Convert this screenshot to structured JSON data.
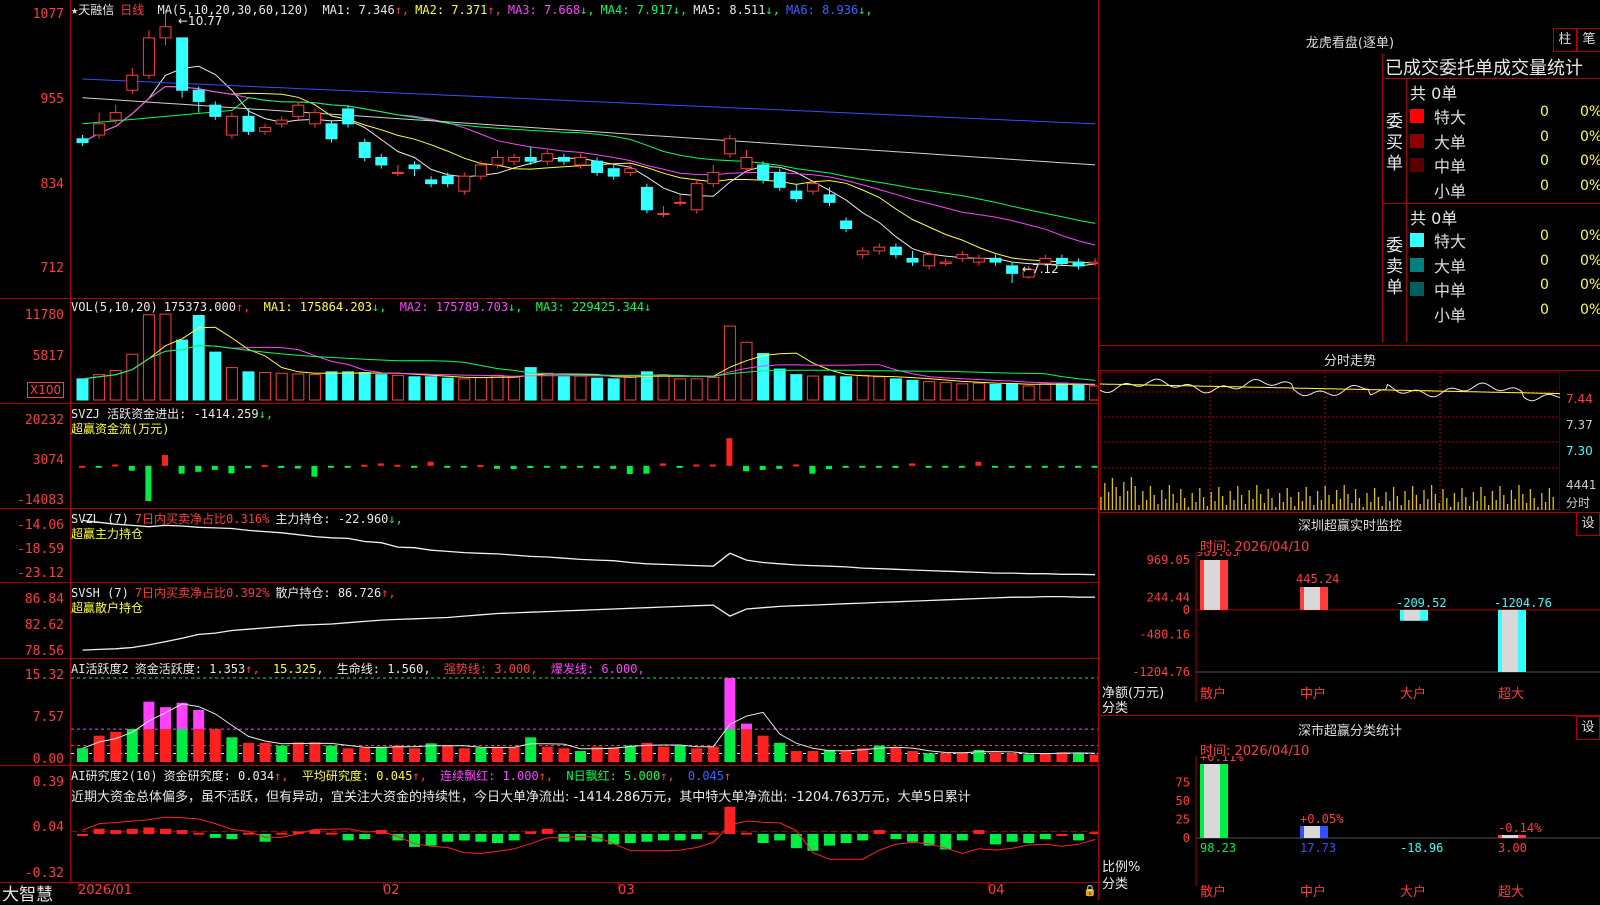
{
  "app": {
    "brand": "大智慧"
  },
  "main_chart": {
    "title": "★天融信",
    "period": "日线",
    "ma_header": "MA(5,10,20,30,60,120)",
    "ma": [
      {
        "label": "MA1: 7.346",
        "color": "#e8e8e8",
        "arrow": "↑",
        "arrow_color": "#ff3b3b"
      },
      {
        "label": "MA2: 7.371",
        "color": "#ffff33",
        "arrow": "↑",
        "arrow_color": "#ff3b3b"
      },
      {
        "label": "MA3: 7.668",
        "color": "#ff40ff",
        "arrow": "↓",
        "arrow_color": "#00ff55"
      },
      {
        "label": "MA4: 7.917",
        "color": "#00ff55",
        "arrow": "↓",
        "arrow_color": "#00ff55"
      },
      {
        "label": "MA5: 8.511",
        "color": "#e8e8e8",
        "arrow": "↓",
        "arrow_color": "#00ff55"
      },
      {
        "label": "MA6: 8.936",
        "color": "#4060ff",
        "arrow": "↓",
        "arrow_color": "#00ff55"
      }
    ],
    "y_ticks": [
      "1077",
      "955",
      "834",
      "712"
    ],
    "high_label": "←10.77",
    "low_label": "←7.12"
  },
  "vol_panel": {
    "header": "VOL(5,10,20)",
    "value": "175373.000",
    "ma1": "MA1: 175864.203",
    "ma2": "MA2: 175789.703",
    "ma3": "MA3: 229425.344",
    "y_ticks": [
      "11780",
      "5817"
    ],
    "unit": "X100"
  },
  "svzj_panel": {
    "header": "SVZJ  活跃资金进出: -1414.259",
    "sub": "超赢资金流(万元)",
    "y_ticks": [
      "20232",
      "3074",
      "-14083"
    ]
  },
  "svzl_panel": {
    "header_a": "SVZL (7)",
    "header_b": "7日内买卖净占比0.316%",
    "header_c": "主力持仓: -22.960",
    "sub": "超赢主力持仓",
    "y_ticks": [
      "-14.06",
      "-18.59",
      "-23.12"
    ]
  },
  "svsh_panel": {
    "header_a": "SVSH (7)",
    "header_b": "7日内买卖净占比0.392%",
    "header_c": "散户持仓: 86.726",
    "sub": "超赢散户持仓",
    "y_ticks": [
      "86.84",
      "82.62",
      "78.56"
    ]
  },
  "ai_active_panel": {
    "header_a": "AI活跃度2",
    "header_b": "资金活跃度: 1.353",
    "header_c": "15.325",
    "header_d": "生命线: 1.560",
    "header_e": "强势线: 3.000",
    "header_f": "爆发线: 6.000",
    "y_ticks": [
      "15.32",
      "7.57",
      "0.00"
    ]
  },
  "ai_research_panel": {
    "header_a": "AI研究度2(10)",
    "header_b": "资金研究度: 0.034",
    "header_c": "平均研究度: 0.045",
    "header_d": "连续飘红: 1.000",
    "header_e": "N日飘红: 5.000",
    "header_f": "0.045",
    "commentary": "近期大资金总体偏多，虽不活跃，但有异动，宜关注大资金的持续性，今日大单净流出: -1414.286万元，其中特大单净流出: -1204.763万元，大单5日累计",
    "y_ticks": [
      "0.39",
      "0.04",
      "-0.32"
    ]
  },
  "x_axis": {
    "labels": [
      "2026/01",
      "02",
      "03",
      "04"
    ]
  },
  "right_panel": {
    "lhb": {
      "title": "龙虎看盘(逐单)",
      "btn1": "柱",
      "btn2": "笔",
      "header": "已成交委托单成交量统计",
      "buy_label": "委买单",
      "sell_label": "委卖单",
      "buy_total": "共 0单",
      "sell_total": "共 0单",
      "buy_rows": [
        {
          "name": "特大",
          "v1": "0",
          "v2": "0%",
          "color": "#ff0000"
        },
        {
          "name": "大单",
          "v1": "0",
          "v2": "0%",
          "color": "#8b0000"
        },
        {
          "name": "中单",
          "v1": "0",
          "v2": "0%",
          "color": "#5a0000"
        },
        {
          "name": "小单",
          "v1": "0",
          "v2": "0%",
          "color": "#000000"
        }
      ],
      "sell_rows": [
        {
          "name": "特大",
          "v1": "0",
          "v2": "0%",
          "color": "#33ffff"
        },
        {
          "name": "大单",
          "v1": "0",
          "v2": "0%",
          "color": "#007f7f"
        },
        {
          "name": "中单",
          "v1": "0",
          "v2": "0%",
          "color": "#005f5f"
        },
        {
          "name": "小单",
          "v1": "0",
          "v2": "0%",
          "color": "#000000"
        }
      ]
    },
    "intraday": {
      "title": "分时走势",
      "y_ticks": [
        "7.44",
        "7.37",
        "7.30"
      ],
      "vol_tick": "4441",
      "vol_unit": "分时"
    },
    "sz_monitor": {
      "title": "深圳超赢实时监控",
      "btn": "设",
      "time": "时间: 2026/04/10",
      "y_ticks": [
        "969.05",
        "244.44",
        "0",
        "-480.16",
        "-1204.76"
      ],
      "ylabel": "净额(万元)",
      "xlabel": "分类",
      "categories": [
        "散户",
        "中户",
        "大户",
        "超大"
      ],
      "values": [
        "969.05",
        "445.24",
        "-209.52",
        "-1204.76"
      ]
    },
    "sz_class": {
      "title": "深市超赢分类统计",
      "btn": "设",
      "time": "时间: 2026/04/10",
      "y_ticks": [
        "75",
        "50",
        "25",
        "0"
      ],
      "ylabel": "比例%",
      "xlabel": "分类",
      "categories": [
        "散户",
        "中户",
        "大户",
        "超大"
      ],
      "top_labels": [
        "+0.11%",
        "+0.05%",
        "",
        "-0.14%"
      ],
      "values": [
        "98.23",
        "17.73",
        "-18.96",
        "3.00"
      ]
    }
  },
  "chart_data": [
    {
      "type": "candlestick",
      "title": "★天融信 日线",
      "ylim": [
        7.0,
        10.8
      ],
      "open": [
        9.05,
        9.1,
        9.3,
        9.7,
        9.9,
        10.4,
        10.4,
        9.7,
        9.5,
        9.1,
        9.35,
        9.15,
        9.25,
        9.35,
        9.25,
        9.25,
        9.45,
        9.0,
        8.8,
        8.6,
        8.7,
        8.5,
        8.55,
        8.35,
        8.55,
        8.7,
        8.75,
        8.8,
        8.75,
        8.8,
        8.7,
        8.75,
        8.65,
        8.6,
        8.4,
        8.05,
        8.2,
        8.1,
        8.45,
        8.85,
        8.65,
        8.7,
        8.6,
        8.35,
        8.35,
        8.3,
        7.95,
        7.5,
        7.55,
        7.6,
        7.45,
        7.35,
        7.38,
        7.45,
        7.4,
        7.45,
        7.35,
        7.2,
        7.38,
        7.45,
        7.4,
        7.38
      ],
      "close": [
        9.0,
        9.25,
        9.4,
        9.9,
        10.4,
        10.55,
        9.7,
        9.55,
        9.35,
        9.35,
        9.15,
        9.2,
        9.3,
        9.5,
        9.4,
        9.05,
        9.25,
        8.8,
        8.7,
        8.6,
        8.65,
        8.45,
        8.45,
        8.55,
        8.7,
        8.8,
        8.8,
        8.75,
        8.85,
        8.75,
        8.8,
        8.6,
        8.55,
        8.65,
        8.1,
        8.05,
        8.2,
        8.45,
        8.6,
        9.05,
        8.8,
        8.5,
        8.4,
        8.25,
        8.45,
        8.2,
        7.85,
        7.55,
        7.6,
        7.5,
        7.4,
        7.5,
        7.4,
        7.5,
        7.45,
        7.4,
        7.25,
        7.3,
        7.45,
        7.38,
        7.35,
        7.4
      ],
      "high": [
        9.1,
        9.4,
        9.5,
        10.0,
        10.5,
        10.77,
        10.4,
        9.75,
        9.55,
        9.4,
        9.45,
        9.25,
        9.35,
        9.55,
        9.45,
        9.3,
        9.5,
        9.05,
        8.85,
        8.7,
        8.75,
        8.55,
        8.6,
        8.6,
        8.75,
        8.9,
        8.85,
        8.95,
        8.9,
        8.85,
        8.85,
        8.8,
        8.7,
        8.7,
        8.45,
        8.15,
        8.3,
        8.5,
        8.7,
        9.1,
        8.9,
        8.75,
        8.65,
        8.45,
        8.5,
        8.4,
        8.0,
        7.6,
        7.65,
        7.65,
        7.55,
        7.55,
        7.45,
        7.55,
        7.5,
        7.5,
        7.4,
        7.35,
        7.5,
        7.5,
        7.45,
        7.45
      ],
      "low": [
        8.95,
        9.05,
        9.25,
        9.65,
        9.85,
        10.3,
        9.6,
        9.4,
        9.3,
        9.05,
        9.1,
        9.1,
        9.2,
        9.3,
        9.2,
        9.0,
        9.2,
        8.75,
        8.65,
        8.55,
        8.55,
        8.4,
        8.4,
        8.3,
        8.5,
        8.65,
        8.7,
        8.7,
        8.7,
        8.7,
        8.65,
        8.55,
        8.5,
        8.55,
        8.05,
        8.0,
        8.15,
        8.05,
        8.4,
        8.8,
        8.6,
        8.45,
        8.35,
        8.2,
        8.3,
        8.15,
        7.8,
        7.45,
        7.5,
        7.45,
        7.35,
        7.3,
        7.35,
        7.4,
        7.35,
        7.35,
        7.12,
        7.18,
        7.35,
        7.35,
        7.3,
        7.35
      ]
    },
    {
      "type": "bar",
      "title": "VOL(5,10,20)",
      "ylim": [
        0,
        12500
      ],
      "values": [
        3000,
        3600,
        4200,
        6500,
        12100,
        12200,
        8500,
        12000,
        6800,
        4600,
        4000,
        3900,
        3800,
        3700,
        3600,
        4000,
        4000,
        3900,
        3600,
        3500,
        3300,
        3300,
        3100,
        3000,
        3200,
        3500,
        3300,
        4600,
        3800,
        3300,
        3400,
        3100,
        3000,
        3300,
        4000,
        3600,
        3000,
        3000,
        3200,
        10500,
        8200,
        6600,
        4400,
        3600,
        3400,
        3400,
        3300,
        3500,
        3300,
        3000,
        2800,
        2600,
        2500,
        2300,
        2400,
        2200,
        2300,
        2000,
        2300,
        2400,
        2100,
        2000
      ],
      "colors_up": "#ff3b3b",
      "colors_down": "#33ffff"
    },
    {
      "type": "bar",
      "title": "SVZJ 活跃资金进出",
      "ylim": [
        -14083,
        20232
      ],
      "values": [
        0,
        -400,
        500,
        -1800,
        -13000,
        4000,
        -2900,
        -2200,
        -1500,
        -2800,
        -900,
        300,
        -800,
        -1000,
        -4000,
        -700,
        -600,
        400,
        900,
        400,
        -500,
        1500,
        -300,
        -300,
        300,
        -1100,
        -1200,
        -800,
        -500,
        -1000,
        -600,
        -900,
        -1100,
        -3000,
        -2900,
        900,
        -800,
        500,
        500,
        10200,
        -2000,
        -1500,
        -1100,
        500,
        -2900,
        -1200,
        -400,
        -400,
        -600,
        -800,
        900,
        -500,
        -400,
        -600,
        1500,
        -400,
        -300,
        -300,
        -400,
        -400,
        -300,
        -300
      ]
    },
    {
      "type": "line",
      "title": "SVZL 主力持仓",
      "ylim": [
        -23.5,
        -13.8
      ],
      "values": [
        -14.2,
        -14.5,
        -14.8,
        -15.0,
        -15.2,
        -15.0,
        -15.1,
        -15.3,
        -15.4,
        -15.5,
        -15.8,
        -16.0,
        -16.2,
        -16.5,
        -16.8,
        -17.0,
        -17.1,
        -17.6,
        -17.8,
        -18.5,
        -18.6,
        -19.0,
        -19.2,
        -19.4,
        -19.5,
        -19.6,
        -19.8,
        -20.0,
        -20.1,
        -20.3,
        -20.5,
        -20.6,
        -20.7,
        -21.0,
        -21.2,
        -21.3,
        -21.4,
        -21.5,
        -21.6,
        -19.5,
        -20.6,
        -21.0,
        -21.2,
        -21.4,
        -21.5,
        -21.6,
        -21.7,
        -21.9,
        -22.0,
        -22.1,
        -22.2,
        -22.3,
        -22.4,
        -22.5,
        -22.6,
        -22.7,
        -22.7,
        -22.8,
        -22.8,
        -22.9,
        -22.9,
        -22.96
      ]
    },
    {
      "type": "line",
      "title": "SVSH 散户持仓",
      "ylim": [
        78.0,
        87.5
      ],
      "values": [
        78.6,
        78.7,
        78.8,
        79.0,
        79.4,
        79.9,
        80.4,
        81.0,
        81.2,
        81.6,
        81.8,
        82.0,
        82.2,
        82.4,
        82.5,
        82.6,
        82.8,
        83.0,
        83.2,
        83.3,
        83.4,
        83.5,
        83.6,
        83.8,
        84.0,
        84.2,
        84.3,
        84.4,
        84.5,
        84.6,
        84.7,
        84.8,
        84.9,
        85.0,
        85.1,
        85.2,
        85.3,
        85.4,
        85.5,
        83.8,
        84.9,
        85.1,
        85.3,
        85.4,
        85.5,
        85.6,
        85.7,
        85.8,
        85.9,
        86.0,
        86.1,
        86.2,
        86.3,
        86.4,
        86.5,
        86.6,
        86.7,
        86.7,
        86.8,
        86.8,
        86.7,
        86.726
      ]
    },
    {
      "type": "bar",
      "title": "AI活跃度2 资金活跃度",
      "ylim": [
        0,
        15.32
      ],
      "values": [
        2.5,
        4.8,
        5.5,
        6.0,
        11.0,
        10.0,
        10.8,
        9.5,
        6.0,
        4.5,
        3.5,
        3.5,
        3.0,
        3.6,
        3.6,
        3.0,
        2.5,
        2.6,
        2.8,
        3.0,
        2.5,
        3.4,
        3.0,
        2.5,
        2.6,
        2.8,
        2.7,
        4.5,
        2.8,
        2.5,
        2.0,
        2.8,
        2.7,
        3.0,
        3.5,
        2.8,
        3.0,
        2.5,
        2.8,
        15.32,
        7.0,
        4.8,
        3.5,
        2.0,
        2.0,
        2.2,
        2.0,
        2.5,
        3.0,
        2.6,
        2.0,
        1.6,
        1.6,
        1.8,
        2.2,
        1.7,
        1.6,
        1.4,
        1.6,
        1.8,
        1.6,
        1.353
      ],
      "reference_lines": {
        "生命线": 1.56,
        "强势线": 3.0,
        "爆发线": 6.0
      }
    },
    {
      "type": "bar",
      "title": "AI研究度2(10)",
      "ylim": [
        -0.32,
        0.39
      ],
      "values": [
        0.02,
        0.06,
        0.05,
        0.06,
        0.07,
        0.06,
        0.05,
        0.03,
        -0.01,
        -0.02,
        0.03,
        -0.04,
        0.03,
        0.04,
        0.05,
        0.03,
        -0.03,
        -0.02,
        0.05,
        -0.03,
        -0.08,
        -0.07,
        -0.04,
        -0.03,
        -0.04,
        -0.05,
        -0.03,
        0.04,
        0.06,
        -0.04,
        -0.03,
        -0.04,
        -0.06,
        -0.05,
        -0.04,
        -0.03,
        -0.03,
        -0.02,
        0.03,
        0.23,
        0.03,
        -0.05,
        -0.03,
        -0.09,
        -0.11,
        -0.07,
        -0.05,
        -0.03,
        0.05,
        -0.02,
        -0.04,
        -0.07,
        -0.1,
        -0.03,
        0.05,
        -0.06,
        -0.04,
        -0.05,
        -0.02,
        0.02,
        -0.03,
        0.034
      ]
    },
    {
      "type": "bar",
      "title": "深圳超赢实时监控",
      "categories": [
        "散户",
        "中户",
        "大户",
        "超大"
      ],
      "values": [
        969.05,
        445.24,
        -209.52,
        -1204.76
      ],
      "ylabel": "净额(万元)",
      "ylim": [
        -1204.76,
        969.05
      ]
    },
    {
      "type": "bar",
      "title": "深市超赢分类统计",
      "categories": [
        "散户",
        "中户",
        "大户",
        "超大"
      ],
      "values": [
        98.23,
        17.73,
        -18.96,
        3.0
      ],
      "ylabel": "比例%",
      "ylim": [
        0,
        100
      ]
    }
  ]
}
